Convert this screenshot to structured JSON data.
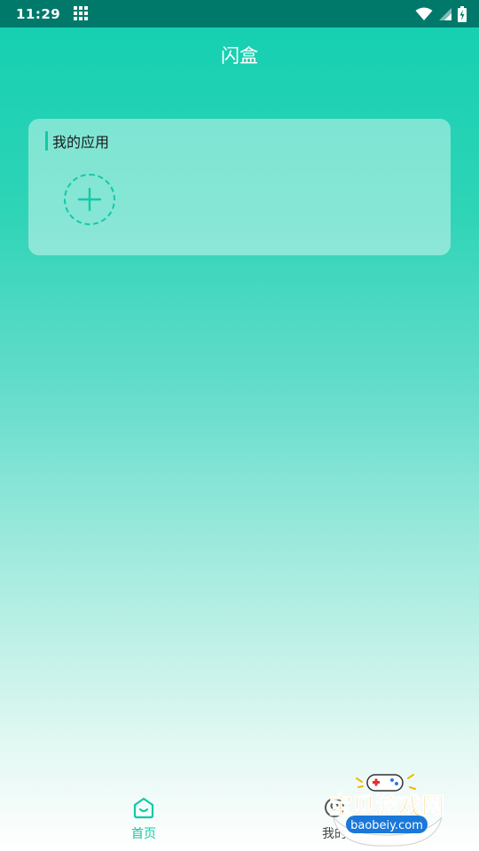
{
  "status_bar": {
    "time": "11:29",
    "icons": [
      "grid-icon",
      "wifi-icon",
      "signal-icon",
      "battery-charging-icon"
    ]
  },
  "header": {
    "title": "闪盒"
  },
  "my_apps": {
    "title": "我的应用",
    "add_button_icon": "plus-icon"
  },
  "bottom_nav": {
    "items": [
      {
        "label": "首页",
        "icon": "home-icon",
        "active": true
      },
      {
        "label": "我的",
        "icon": "profile-icon",
        "active": false
      }
    ]
  },
  "watermark": {
    "text": "宝贝游戏网",
    "subtext": "baobeiy.com"
  },
  "colors": {
    "accent": "#12c9a8",
    "status_bar": "#00796b",
    "gradient_top": "#12cfb0",
    "gradient_bottom": "#ffffff"
  }
}
